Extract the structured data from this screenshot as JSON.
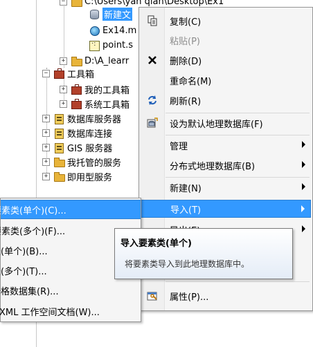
{
  "tree": {
    "path_node": "C:\\Users\\yan qian\\Desktop\\Ex1",
    "selected_node": "新建文",
    "child_mxd": "Ex14.m",
    "child_shp": "point.s",
    "folder_d": "D:\\A_learr",
    "toolbox": "工具箱",
    "my_toolbox": "我的工具箱",
    "sys_toolbox": "系统工具箱",
    "db_servers": "数据库服务器",
    "db_connections": "数据库连接",
    "gis_servers": "GIS 服务器",
    "hosted_services": "我托管的服务",
    "ready_services": "即用型服务"
  },
  "context_menu": {
    "copy": "复制(C)",
    "paste": "粘贴(P)",
    "delete": "删除(D)",
    "rename": "重命名(M)",
    "refresh": "刷新(R)",
    "set_default": "设为默认地理数据库(F)",
    "manage": "管理",
    "distributed": "分布式地理数据库(B)",
    "new": "新建(N)",
    "import": "导入(T)",
    "export_partial": "导出(E)",
    "properties": "属性(P)..."
  },
  "submenu": {
    "items": [
      "要素类(单个)(C)...",
      "要素类(多个)(F)...",
      "表(单个)(B)...",
      "表(多个)(T)...",
      "栅格数据集(R)...",
      "XML 工作空间文档(W)..."
    ]
  },
  "tooltip": {
    "title": "导入要素类(单个)",
    "body": "将要素类导入到此地理数据库中。"
  },
  "icons": {
    "copy": "copy-icon",
    "delete": "delete-icon",
    "refresh": "refresh-icon",
    "set_default": "geodatabase-default-icon",
    "properties": "properties-icon"
  },
  "colors": {
    "highlight": "#3399ff",
    "menu_bg": "#f5f5f5",
    "disabled_text": "#8d8d8d"
  }
}
